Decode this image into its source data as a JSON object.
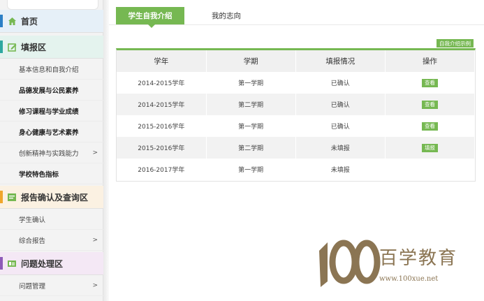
{
  "sidebar": {
    "sections": [
      {
        "title": "首页",
        "color": "#4a9fd8",
        "icon": "home-icon"
      },
      {
        "title": "填报区",
        "color": "#76b852",
        "icon": "edit-icon",
        "items": [
          {
            "label": "基本信息和自我介绍",
            "bold": false
          },
          {
            "label": "品德发展与公民素养",
            "bold": true
          },
          {
            "label": "修习课程与学业成绩",
            "bold": true
          },
          {
            "label": "身心健康与艺术素养",
            "bold": true
          },
          {
            "label": "创新精神与实践能力",
            "bold": false,
            "chevron": ">"
          },
          {
            "label": "学校特色指标",
            "bold": true
          }
        ]
      },
      {
        "title": "报告确认及查询区",
        "color": "#f0a62c",
        "icon": "report-icon",
        "items": [
          {
            "label": "学生确认",
            "bold": false
          },
          {
            "label": "综合报告",
            "bold": false,
            "chevron": ">"
          }
        ]
      },
      {
        "title": "问题处理区",
        "color": "#8e5bb8",
        "icon": "problem-icon",
        "items": [
          {
            "label": "问题管理",
            "bold": false,
            "chevron": ">"
          }
        ]
      }
    ]
  },
  "tabs": {
    "active": "学生自我介绍",
    "other": "我的志向"
  },
  "example_button": "自我介绍示例",
  "table": {
    "headers": [
      "学年",
      "学期",
      "填报情况",
      "操作"
    ],
    "rows": [
      {
        "year": "2014-2015学年",
        "term": "第一学期",
        "status": "已确认",
        "action": "查看"
      },
      {
        "year": "2014-2015学年",
        "term": "第二学期",
        "status": "已确认",
        "action": "查看"
      },
      {
        "year": "2015-2016学年",
        "term": "第一学期",
        "status": "已确认",
        "action": "查看"
      },
      {
        "year": "2015-2016学年",
        "term": "第二学期",
        "status": "未填报",
        "action": "填报"
      },
      {
        "year": "2016-2017学年",
        "term": "第一学期",
        "status": "未填报",
        "action": ""
      }
    ]
  },
  "watermark": {
    "brand": "百学教育",
    "url": "www.100xue.net"
  },
  "colors": {
    "accent": "#76b852",
    "watermark": "#8b7553"
  }
}
